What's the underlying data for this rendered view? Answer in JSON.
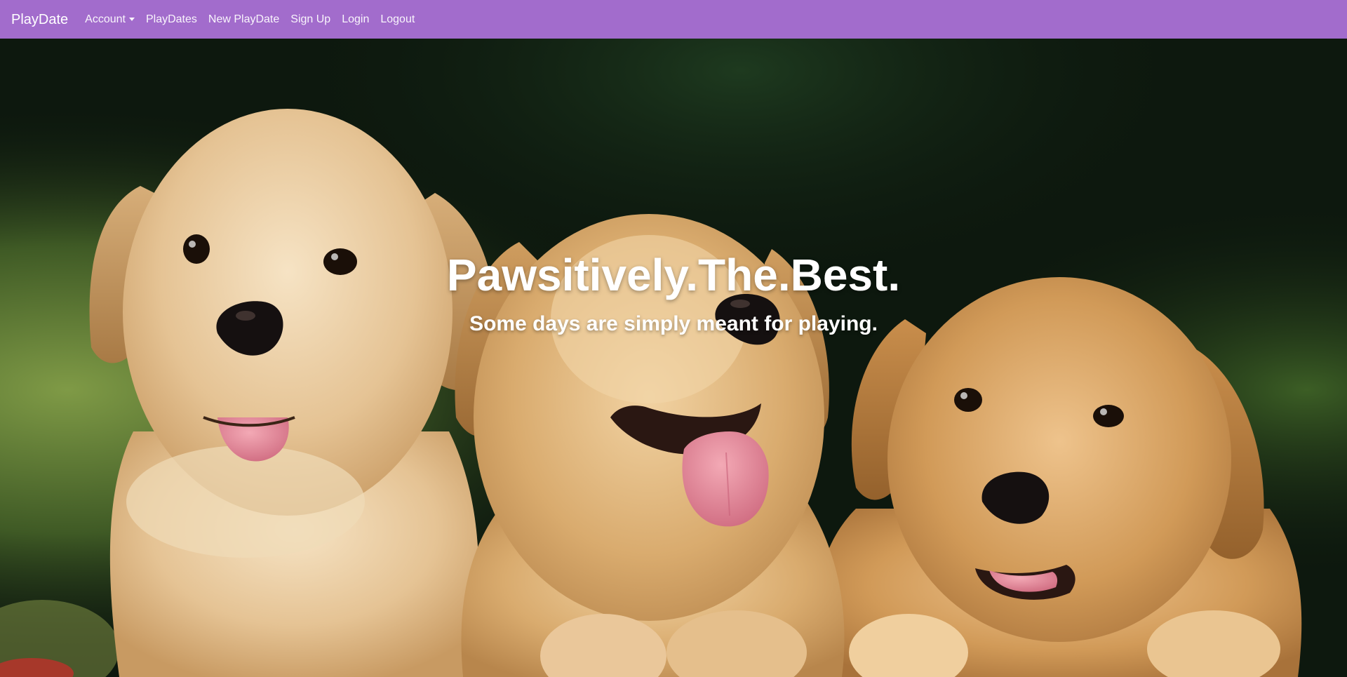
{
  "nav": {
    "brand": "PlayDate",
    "account_label": "Account",
    "playdates_label": "PlayDates",
    "new_playdate_label": "New PlayDate",
    "signup_label": "Sign Up",
    "login_label": "Login",
    "logout_label": "Logout"
  },
  "hero": {
    "title": "Pawsitively.The.Best.",
    "subtitle": "Some days are simply meant for playing.",
    "image": "three-golden-retriever-puppies"
  },
  "colors": {
    "navbar": "#a26ccc",
    "text": "#ffffff"
  }
}
